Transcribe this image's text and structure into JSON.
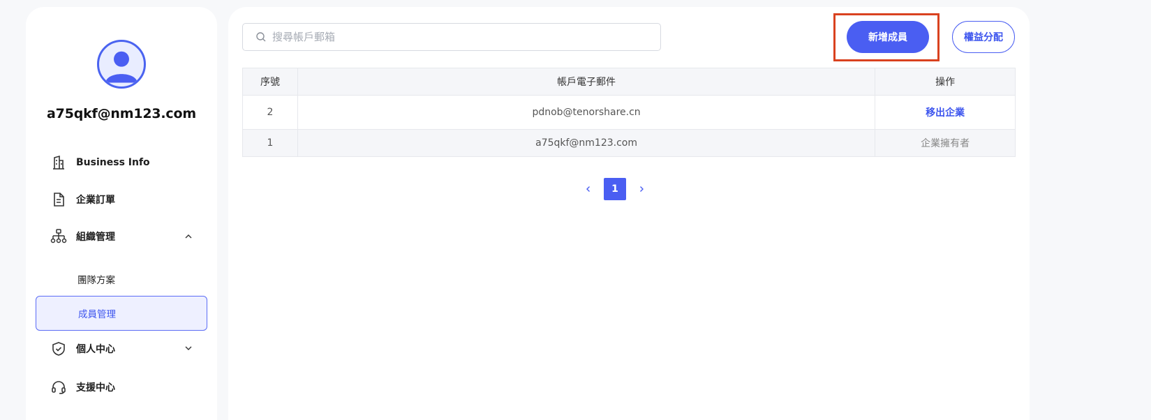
{
  "user": {
    "email": "a75qkf@nm123.com"
  },
  "sidebar": {
    "items": [
      {
        "label": "Business Info",
        "icon": "building-icon"
      },
      {
        "label": "企業訂單",
        "icon": "document-icon"
      },
      {
        "label": "組織管理",
        "icon": "org-chart-icon",
        "expanded": true
      },
      {
        "label": "個人中心",
        "icon": "shield-check-icon",
        "expanded": false
      },
      {
        "label": "支援中心",
        "icon": "headset-icon"
      }
    ],
    "subitems": [
      {
        "label": "團隊方案",
        "active": false
      },
      {
        "label": "成員管理",
        "active": true
      }
    ]
  },
  "search": {
    "placeholder": "搜尋帳戶郵箱",
    "value": ""
  },
  "toolbar": {
    "add_label": "新增成員",
    "perm_label": "權益分配"
  },
  "table": {
    "columns": [
      "序號",
      "帳戶電子郵件",
      "操作"
    ],
    "rows": [
      {
        "no": "2",
        "email": "pdnob@tenorshare.cn",
        "op": "移出企業"
      },
      {
        "no": "1",
        "email": "a75qkf@nm123.com",
        "op": "企業擁有者"
      }
    ]
  },
  "pagination": {
    "current": "1"
  },
  "colors": {
    "accent": "#4a5ef2",
    "highlight": "#d9421f"
  }
}
